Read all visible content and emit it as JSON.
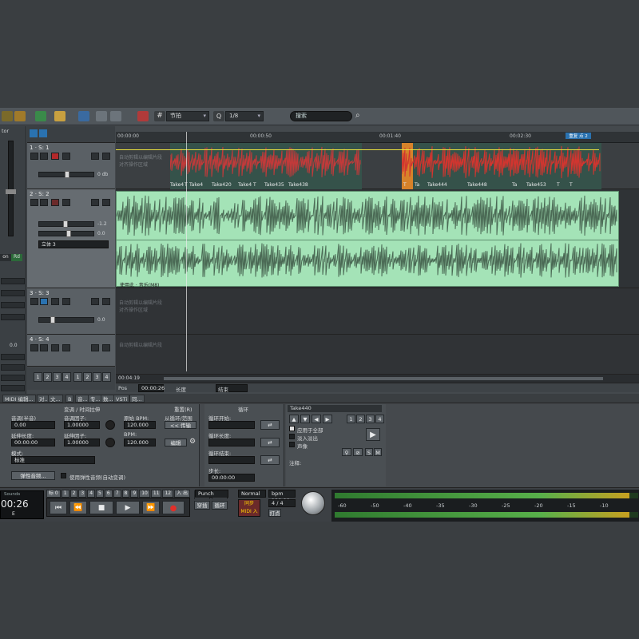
{
  "app": {
    "left_label": "tor",
    "toolbar": {
      "snap_label": "节拍",
      "quant_label": "1/8",
      "search_placeholder": "搜索"
    },
    "ruler": {
      "ticks": [
        "00:00:00",
        "00:00:50",
        "00:01:40",
        "00:02:30"
      ],
      "marker_label": "重复 点 2"
    },
    "left_panel": {
      "buttons": [
        "on",
        "Rd"
      ],
      "value": "0.0"
    },
    "tracks": [
      {
        "num": "1",
        "name": "S: 1",
        "vol_val": "0 db"
      },
      {
        "num": "2",
        "name": "S: 2",
        "vol_val": "-1.2",
        "pan_val": "0.0",
        "send_label": "立体 3"
      },
      {
        "num": "3",
        "name": "S: 3",
        "vol_val": "0.0"
      },
      {
        "num": "4",
        "name": "S: 4",
        "vol_val": ""
      }
    ],
    "track_groups": {
      "set_a": [
        "1",
        "2",
        "3",
        "4"
      ],
      "set_b": [
        "1",
        "2",
        "3",
        "4"
      ]
    },
    "track1_clips": [
      "Take4",
      "T",
      "Take4",
      "Take420",
      "Take4",
      "T",
      "Take435",
      "Take438",
      "T",
      "Ta",
      "Take444",
      "Take448",
      "Ta",
      "Take453",
      "T",
      "T"
    ],
    "track1_overlay": [
      "自动剪辑以编辑片段",
      "对齐操作区域"
    ],
    "track2_clip_label": "使用此 · 音乐(M8)",
    "track3_overlay": [
      "自动剪辑以编辑片段",
      "对齐操作区域"
    ],
    "track4_overlay": [
      "自动剪辑以编辑片段"
    ],
    "time_display": "00:04:19",
    "status": {
      "pos_label": "Pos",
      "pos_value": "00:00:26",
      "length_label": "长度",
      "end_label": "结束"
    },
    "bottom_tabs": [
      "MIDI 编辑...",
      "对...",
      "文...",
      "B",
      "音...",
      "专...",
      "数...",
      "VSTi",
      "同..."
    ],
    "loop_panel": {
      "header": "变调 / 时间拉伸",
      "header_right": "重置(R)",
      "orig_tempo_label": "音调(半音)",
      "orig_tempo_value": "0.00",
      "time_ratio_label": "音调因子:",
      "time_ratio_value": "1.00000",
      "orig_bpm_label": "原始 BPM:",
      "orig_bpm_value": "120.000",
      "from_loop_label": "从循环/范围",
      "from_loop_button": "<< 传输",
      "stretch_len_label": "延伸长度:",
      "stretch_len_value": "00:00:00",
      "stretch_factor_label": "延伸因子:",
      "stretch_factor_value": "1.00000",
      "bpm_label": "BPM:",
      "bpm_value": "120.000",
      "edit_button": "编辑",
      "mode_label": "模式:",
      "mode_value": "标准",
      "elastic_button": "弹性音频...",
      "use_elastic_label": "使用弹性音频(自动变调)"
    },
    "loop2_panel": {
      "header": "循环",
      "loop_start_label": "循环开始:",
      "loop_len_label": "循环长度:",
      "loop_end_label": "循环结束:",
      "step_label": "步长:",
      "step_value": "00:00:00"
    },
    "take_panel": {
      "header": "Take440",
      "nums": [
        "1",
        "2",
        "3",
        "4"
      ],
      "opt1": "应用于全部",
      "opt2": "淡入淡出",
      "opt3": "声像",
      "note_label": "注释:",
      "s_btn": "S",
      "m_btn": "M"
    },
    "transport": {
      "time_caption": "Sounds",
      "time": "00:26",
      "sub": "E",
      "ticks": [
        "标 0",
        "1",
        "2",
        "3",
        "4",
        "5",
        "6",
        "7",
        "8",
        "9",
        "10",
        "11",
        "12",
        "入 出"
      ],
      "punch_value": "Punch",
      "playmode_value": "Normal",
      "bpm_value": "bpm 120.00",
      "sig_value": "4 / 4",
      "sync_label": "同步",
      "midi_in": "MIDI 入",
      "hit_label": "打点",
      "a_btn": "宏鼓",
      "b_btn": "同步",
      "c_btn": "穿插",
      "d_btn": "循环"
    },
    "meter_scale": [
      "-60",
      "-50",
      "-40",
      "-35",
      "-30",
      "-25",
      "-20",
      "-15",
      "-10"
    ],
    "meter_levels": [
      0.97,
      0.97
    ]
  }
}
